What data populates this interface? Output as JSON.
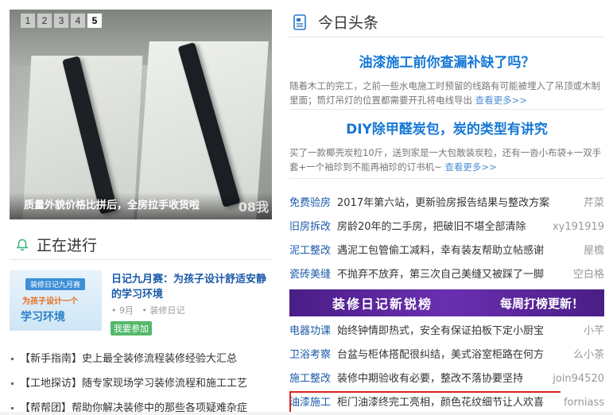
{
  "slider": {
    "pages": [
      "1",
      "2",
      "3",
      "4",
      "5"
    ],
    "active_page": "5",
    "caption": "质量外貌价格比拼后，全房拉手收货啦",
    "watermark": "08我"
  },
  "in_progress": {
    "title": "正在进行",
    "diary": {
      "thumb_tag": "装修日记九月赛",
      "thumb_line1": "为孩子设计一个",
      "thumb_line2": "学习环境",
      "title": "日记九月赛：为孩子设计舒适安静的学习环境",
      "month": "9月",
      "category": "装修日记",
      "join_label": "我要参加"
    },
    "news": [
      "【新手指南】史上最全装修流程装修经验大汇总",
      "【工地探访】随专家现场学习装修流程和施工工艺",
      "【帮帮团】帮助你解决装修中的那些各项疑难杂症"
    ]
  },
  "headlines": {
    "title": "今日头条",
    "featured": [
      {
        "title": "油漆施工前你查漏补缺了吗？",
        "desc": "随着木工的完工，之前一些水电施工时预留的线路有可能被埋入了吊顶或木制里面；筒灯吊灯的位置都需要开孔将电线导出",
        "more": "查看更多>>"
      },
      {
        "title": "DIY除甲醛炭包，炭的类型有讲究",
        "desc": "买了一款椰壳炭粒10斤，送到家是一大包散装炭粒，还有一沓小布袋+一双手套+一个袖珍到不能再袖珍的订书机~",
        "more": "查看更多>>"
      }
    ],
    "list1": [
      {
        "cat": "免费验房",
        "text": "2017年第六站，更新验房报告结果与整改方案",
        "author": "芹菜"
      },
      {
        "cat": "旧房拆改",
        "text": "房龄20年的二手房，把破旧不堪全部清除",
        "author": "xy191919"
      },
      {
        "cat": "泥工整改",
        "text": "遇泥工包管偷工减料，幸有装友帮助立帖感谢",
        "author": "屋檐"
      },
      {
        "cat": "瓷砖美缝",
        "text": "不抛弃不放弃，第三次自己美缝又被踩了一脚",
        "author": "空白格"
      }
    ],
    "banner": {
      "left": "装修日记新锐榜",
      "right": "每周打榜更新！"
    },
    "list2": [
      {
        "cat": "电器功课",
        "text": "始终钟情即热式，安全有保证拍板下定小厨宝",
        "author": "小芊"
      },
      {
        "cat": "卫浴考察",
        "text": "台盆与柜体搭配很纠结，美式浴室柜路在何方",
        "author": "么小茶"
      },
      {
        "cat": "施工整改",
        "text": "装修中期验收有必要，整改不落协要坚持",
        "author": "join94520"
      },
      {
        "cat": "油漆施工",
        "text": "柜门油漆终完工亮相，颜色花纹细节让人欢喜",
        "author": "forniass"
      }
    ]
  },
  "colors": {
    "link_blue": "#1b5aa8",
    "feature_blue": "#1678d6",
    "join_green": "#52b96a",
    "banner_purple": "#5a2598",
    "highlight_red": "#d9231f"
  }
}
